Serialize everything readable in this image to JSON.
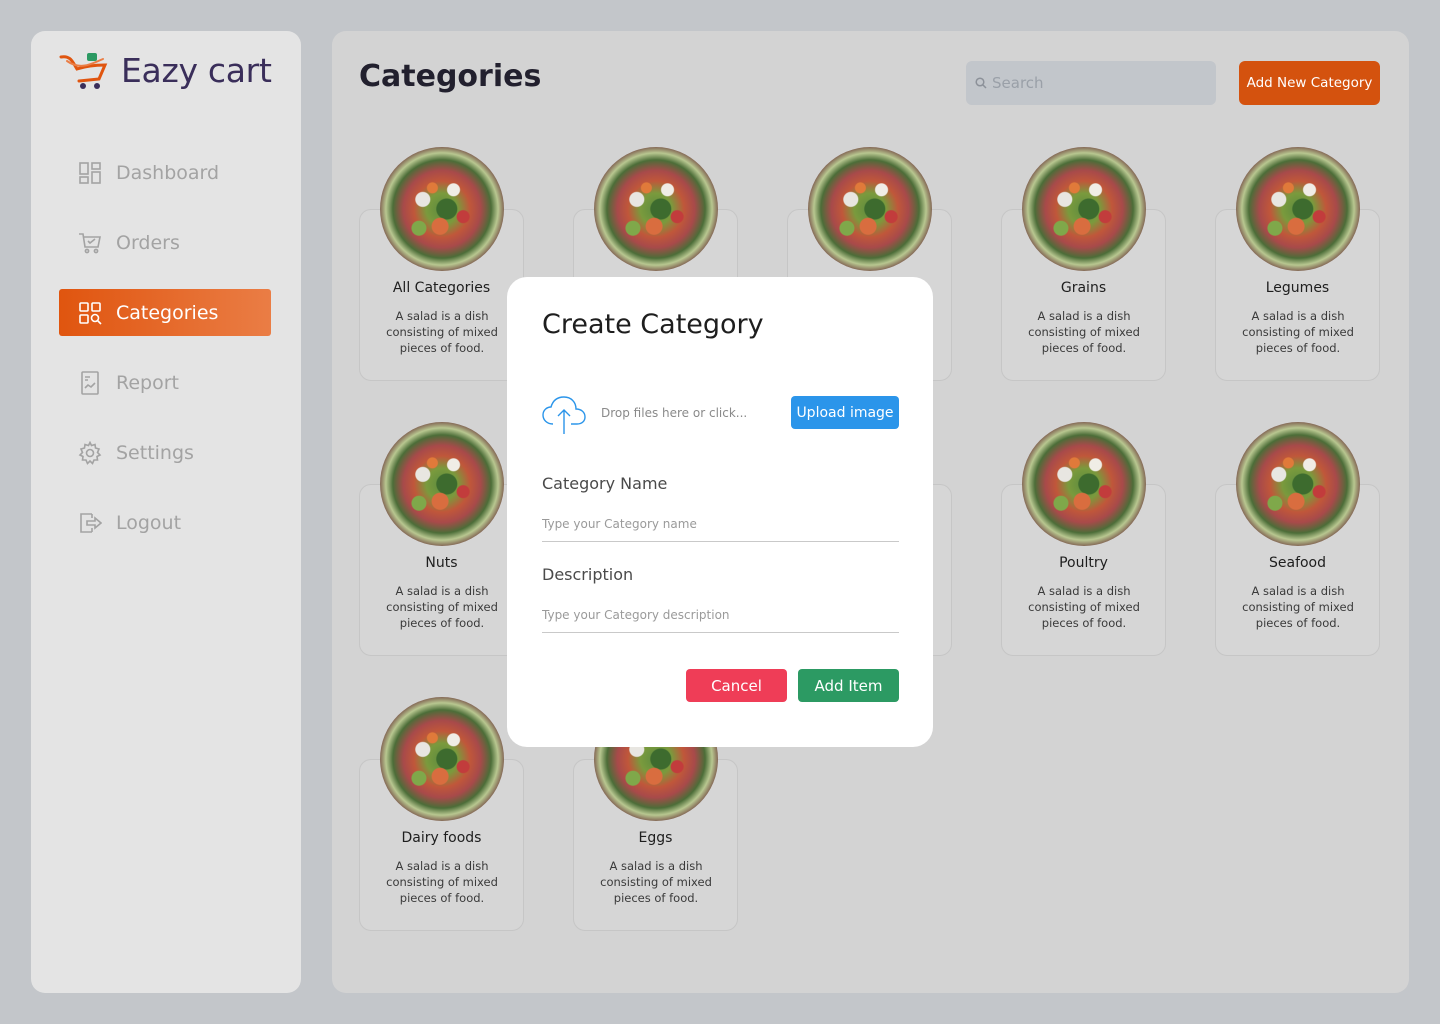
{
  "brand": {
    "name": "Eazy cart",
    "accent": "#e0550f"
  },
  "sidebar": {
    "items": [
      {
        "label": "Dashboard",
        "icon": "dashboard-icon"
      },
      {
        "label": "Orders",
        "icon": "cart-icon"
      },
      {
        "label": "Categories",
        "icon": "categories-icon",
        "active": true
      },
      {
        "label": "Report",
        "icon": "report-icon"
      },
      {
        "label": "Settings",
        "icon": "gear-icon"
      },
      {
        "label": "Logout",
        "icon": "logout-icon"
      }
    ]
  },
  "header": {
    "title": "Categories",
    "search_placeholder": "Search",
    "add_button": "Add New Category"
  },
  "categories": [
    {
      "name": "All Categories",
      "description": "A salad is a dish consisting of mixed pieces of food."
    },
    {
      "name": "",
      "description": ""
    },
    {
      "name": "",
      "description": ""
    },
    {
      "name": "Grains",
      "description": "A salad is a dish consisting of mixed pieces of food."
    },
    {
      "name": "Legumes",
      "description": "A salad is a dish consisting of mixed pieces of food."
    },
    {
      "name": "Nuts",
      "description": "A salad is a dish consisting of mixed pieces of food."
    },
    {
      "name": "",
      "description": ""
    },
    {
      "name": "",
      "description": ""
    },
    {
      "name": "Poultry",
      "description": "A salad is a dish consisting of mixed pieces of food."
    },
    {
      "name": "Seafood",
      "description": "A salad is a dish consisting of mixed pieces of food."
    },
    {
      "name": "Dairy foods",
      "description": "A salad is a dish consisting of mixed pieces of food."
    },
    {
      "name": "Eggs",
      "description": "A salad is a dish consisting of mixed pieces of food."
    }
  ],
  "modal": {
    "title": "Create Category",
    "drop_text": "Drop files here or click...",
    "upload_button": "Upload image",
    "name_label": "Category Name",
    "name_placeholder": "Type your Category name",
    "description_label": "Description",
    "description_placeholder": "Type your Category description",
    "cancel_button": "Cancel",
    "add_button": "Add Item"
  }
}
